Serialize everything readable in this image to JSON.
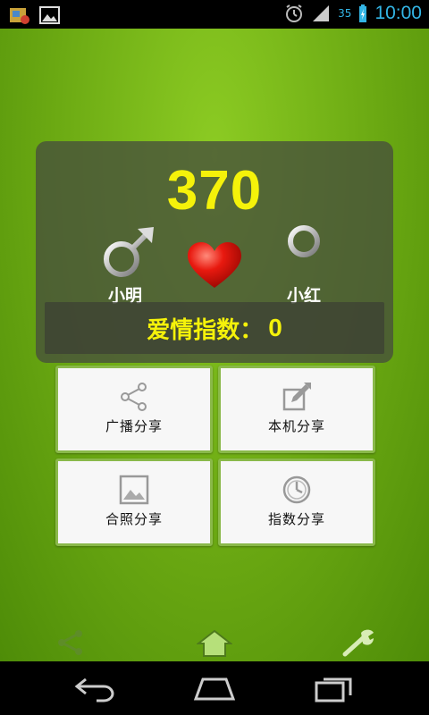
{
  "status_bar": {
    "battery_level": "35",
    "time": "10:00"
  },
  "main": {
    "score": "370",
    "male_name": "小明",
    "female_name": "小红",
    "index_label": "爱情指数：",
    "index_value": "0"
  },
  "tiles": [
    {
      "label": "广播分享",
      "icon": "share-icon"
    },
    {
      "label": "本机分享",
      "icon": "edit-share-icon"
    },
    {
      "label": "合照分享",
      "icon": "photo-icon"
    },
    {
      "label": "指数分享",
      "icon": "clock-icon"
    }
  ],
  "bottom_bar": {
    "icons": [
      "share-icon",
      "home-icon",
      "wrench-icon"
    ]
  },
  "colors": {
    "accent_yellow": "#f5f20a",
    "status_blue": "#33b5e5",
    "tile_border": "#8ab94a"
  }
}
